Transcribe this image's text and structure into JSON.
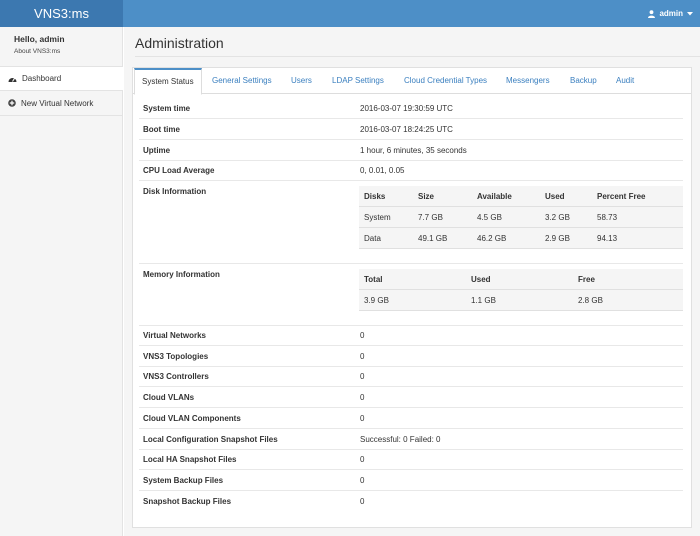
{
  "app": {
    "title": "VNS3:ms"
  },
  "user_menu": {
    "label": "admin"
  },
  "sidebar": {
    "greeting": "Hello, admin",
    "about": "About VNS3:ms",
    "items": [
      {
        "label": "Dashboard",
        "icon": "dashboard-icon"
      },
      {
        "label": "New Virtual Network",
        "icon": "plus-circle-icon"
      }
    ]
  },
  "page": {
    "title": "Administration"
  },
  "tabs": [
    {
      "label": "System Status",
      "active": true
    },
    {
      "label": "General Settings"
    },
    {
      "label": "Users"
    },
    {
      "label": "LDAP Settings"
    },
    {
      "label": "Cloud Credential Types"
    },
    {
      "label": "Messengers"
    },
    {
      "label": "Backup"
    },
    {
      "label": "Audit"
    }
  ],
  "status": {
    "system_time": {
      "label": "System time",
      "value": "2016-03-07 19:30:59 UTC"
    },
    "boot_time": {
      "label": "Boot time",
      "value": "2016-03-07 18:24:25 UTC"
    },
    "uptime": {
      "label": "Uptime",
      "value": "1 hour, 6 minutes, 35 seconds"
    },
    "cpu": {
      "label": "CPU Load Average",
      "value": "0, 0.01, 0.05"
    },
    "disk": {
      "label": "Disk Information",
      "headers": [
        "Disks",
        "Size",
        "Available",
        "Used",
        "Percent Free"
      ],
      "rows": [
        [
          "System",
          "7.7 GB",
          "4.5 GB",
          "3.2 GB",
          "58.73"
        ],
        [
          "Data",
          "49.1 GB",
          "46.2 GB",
          "2.9 GB",
          "94.13"
        ]
      ]
    },
    "memory": {
      "label": "Memory Information",
      "headers": [
        "Total",
        "Used",
        "Free"
      ],
      "rows": [
        [
          "3.9 GB",
          "1.1 GB",
          "2.8 GB"
        ]
      ]
    },
    "virtual_networks": {
      "label": "Virtual Networks",
      "value": "0"
    },
    "topologies": {
      "label": "VNS3 Topologies",
      "value": "0"
    },
    "controllers": {
      "label": "VNS3 Controllers",
      "value": "0"
    },
    "cloud_vlans": {
      "label": "Cloud VLANs",
      "value": "0"
    },
    "cloud_vlan_components": {
      "label": "Cloud VLAN Components",
      "value": "0"
    },
    "local_config_snapshots": {
      "label": "Local Configuration Snapshot Files",
      "value": "Successful: 0 Failed: 0"
    },
    "local_ha_snapshots": {
      "label": "Local HA Snapshot Files",
      "value": "0"
    },
    "system_backups": {
      "label": "System Backup Files",
      "value": "0"
    },
    "snapshot_backups": {
      "label": "Snapshot Backup Files",
      "value": "0"
    }
  },
  "colors": {
    "navbar": "#4d8fc7",
    "brand": "#3c78b0",
    "link": "#3a7fbf"
  }
}
